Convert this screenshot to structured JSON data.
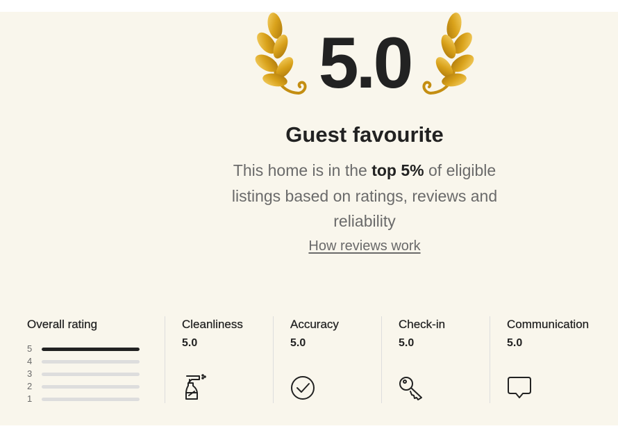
{
  "hero": {
    "score": "5.0",
    "title": "Guest favourite",
    "desc_prefix": "This home is in the ",
    "desc_bold": "top 5%",
    "desc_suffix": " of eligible listings based on ratings, reviews and reliability",
    "link": "How reviews work",
    "laurel_color": "#d4a017"
  },
  "overall": {
    "heading": "Overall rating",
    "bars": [
      {
        "label": "5",
        "fraction": 1.0
      },
      {
        "label": "4",
        "fraction": 0.0
      },
      {
        "label": "3",
        "fraction": 0.0
      },
      {
        "label": "2",
        "fraction": 0.0
      },
      {
        "label": "1",
        "fraction": 0.0
      }
    ]
  },
  "categories": [
    {
      "name": "Cleanliness",
      "value": "5.0",
      "icon": "spray-bottle-icon"
    },
    {
      "name": "Accuracy",
      "value": "5.0",
      "icon": "check-circle-icon"
    },
    {
      "name": "Check-in",
      "value": "5.0",
      "icon": "key-icon"
    },
    {
      "name": "Communication",
      "value": "5.0",
      "icon": "chat-bubble-icon"
    }
  ],
  "colors": {
    "background": "#f9f6ec",
    "text": "#222222",
    "muted": "#6a6a6a",
    "divider": "#dddddd"
  }
}
